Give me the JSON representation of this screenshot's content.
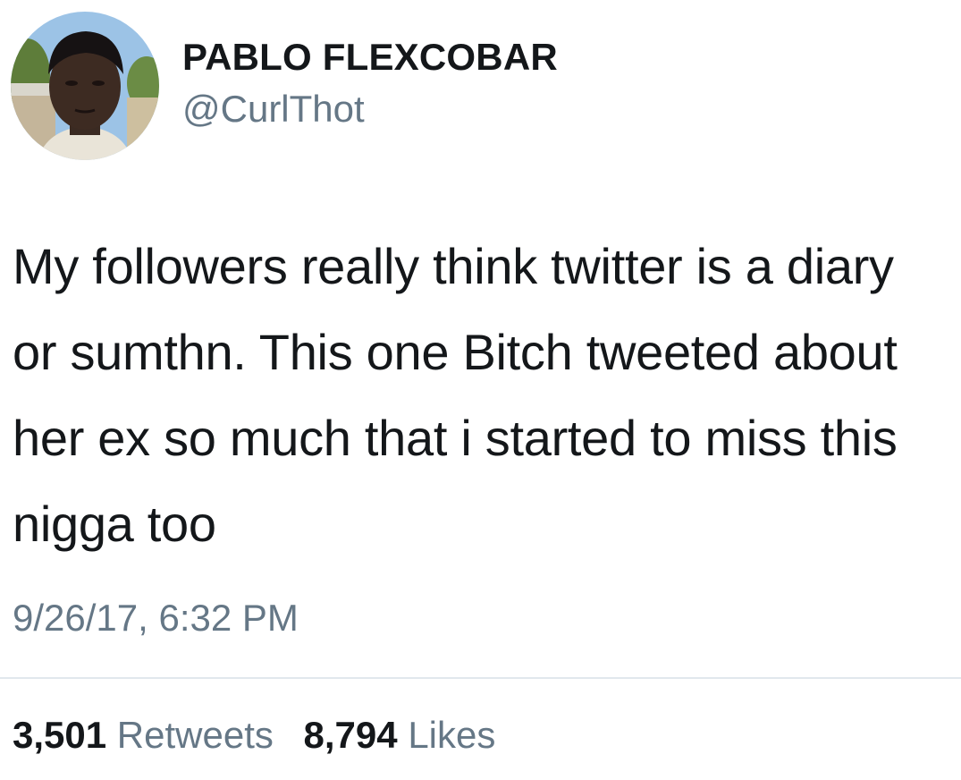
{
  "user": {
    "display_name": "PABLO FLEXCOBAR",
    "handle": "@CurlThot",
    "avatar_icon": "profile-photo"
  },
  "tweet": {
    "text": "My followers really think twitter is a diary or sumthn. This one Bitch tweeted about her ex so much that i started to miss this nigga too",
    "timestamp": "9/26/17, 6:32 PM"
  },
  "stats": {
    "retweets_count": "3,501",
    "retweets_label": "Retweets",
    "likes_count": "8,794",
    "likes_label": "Likes"
  },
  "colors": {
    "text_primary": "#14171a",
    "text_secondary": "#657786",
    "divider": "#e1e8ed"
  }
}
